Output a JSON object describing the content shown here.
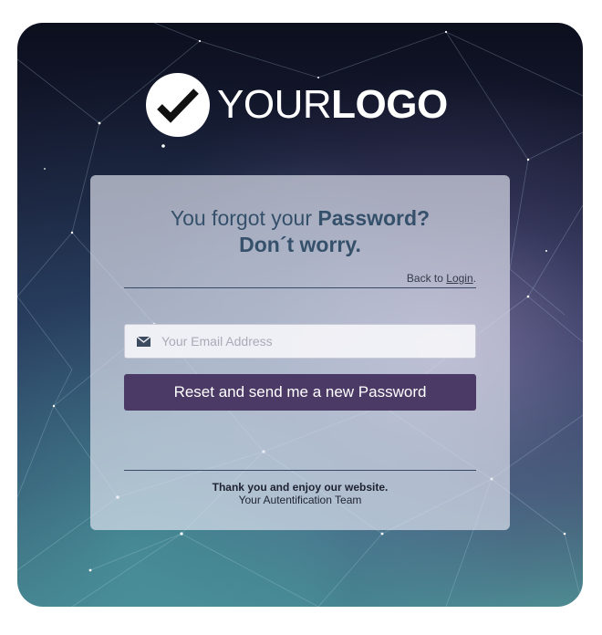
{
  "logo": {
    "icon": "checkmark-icon",
    "text_light": "YOUR",
    "text_bold": "LOGO"
  },
  "card": {
    "heading_prefix": "You forgot your ",
    "heading_bold": "Password?",
    "subheading": "Don´t worry.",
    "back_prefix": "Back to ",
    "back_link": "Login",
    "back_suffix": ".",
    "email": {
      "icon": "envelope-icon",
      "placeholder": "Your Email Address",
      "value": ""
    },
    "reset_label": "Reset and send me a new Password",
    "thanks": "Thank you and enjoy our website.",
    "team": "Your Autentification Team"
  },
  "colors": {
    "heading": "#35506a",
    "button": "#4b3a66",
    "card_bg": "rgba(225,228,240,0.68)"
  }
}
